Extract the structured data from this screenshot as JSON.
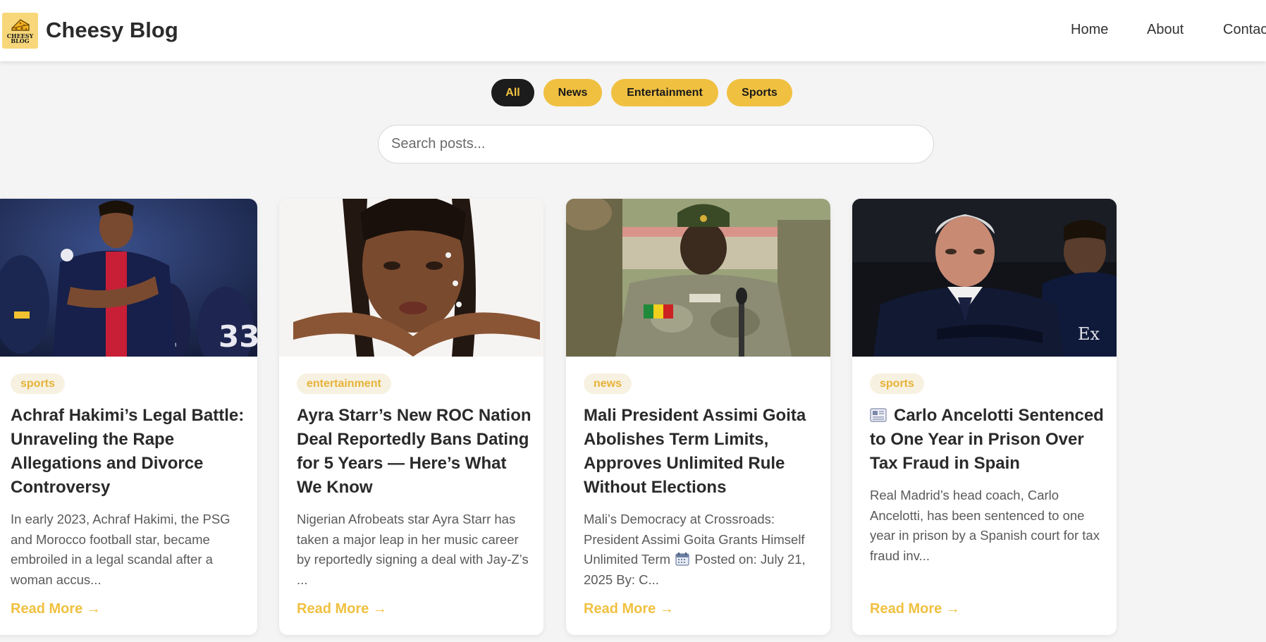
{
  "header": {
    "brand": "Cheesy Blog",
    "logo_text": "CHEESY BLOG",
    "nav": [
      {
        "label": "Home"
      },
      {
        "label": "About"
      },
      {
        "label": "Contact"
      }
    ]
  },
  "filters": [
    {
      "label": "All",
      "active": true
    },
    {
      "label": "News",
      "active": false
    },
    {
      "label": "Entertainment",
      "active": false
    },
    {
      "label": "Sports",
      "active": false
    }
  ],
  "search": {
    "placeholder": "Search posts...",
    "value": ""
  },
  "posts": [
    {
      "category": "sports",
      "title": "Achraf Hakimi’s Legal Battle: Unraveling the Rape Allegations and Divorce Controversy",
      "excerpt": "In early 2023, Achraf Hakimi, the PSG and Morocco football star, became embroiled in a legal scandal after a woman accus...",
      "read_more": "Read More →",
      "image_icon": "football-player-photo"
    },
    {
      "category": "entertainment",
      "title": "Ayra Starr’s New ROC Nation Deal Reportedly Bans Dating for 5 Years — Here’s What We Know",
      "excerpt": "Nigerian Afrobeats star Ayra Starr has taken a major leap in her music career by reportedly signing a deal with Jay-Z’s ...",
      "read_more": "Read More →",
      "image_icon": "portrait-photo"
    },
    {
      "category": "news",
      "title": "Mali President Assimi Goita Abolishes Term Limits, Approves Unlimited Rule Without Elections",
      "excerpt_before": "Mali’s Democracy at Crossroads: President Assimi Goita Grants Himself Unlimited Term",
      "excerpt_after": "Posted on: July 21, 2025 By: C...",
      "read_more": "Read More →",
      "image_icon": "military-officer-photo"
    },
    {
      "category": "sports",
      "title": "Carlo Ancelotti Sentenced to One Year in Prison Over Tax Fraud in Spain",
      "excerpt": "Real Madrid’s head coach, Carlo Ancelotti, has been sentenced to one year in prison by a Spanish court for tax fraud inv...",
      "read_more": "Read More →",
      "image_icon": "coach-photo"
    }
  ],
  "colors": {
    "accent": "#f0c040",
    "dark": "#1c1c1c",
    "tag_bg": "#f7f1e1",
    "background": "#f4f4f4"
  }
}
